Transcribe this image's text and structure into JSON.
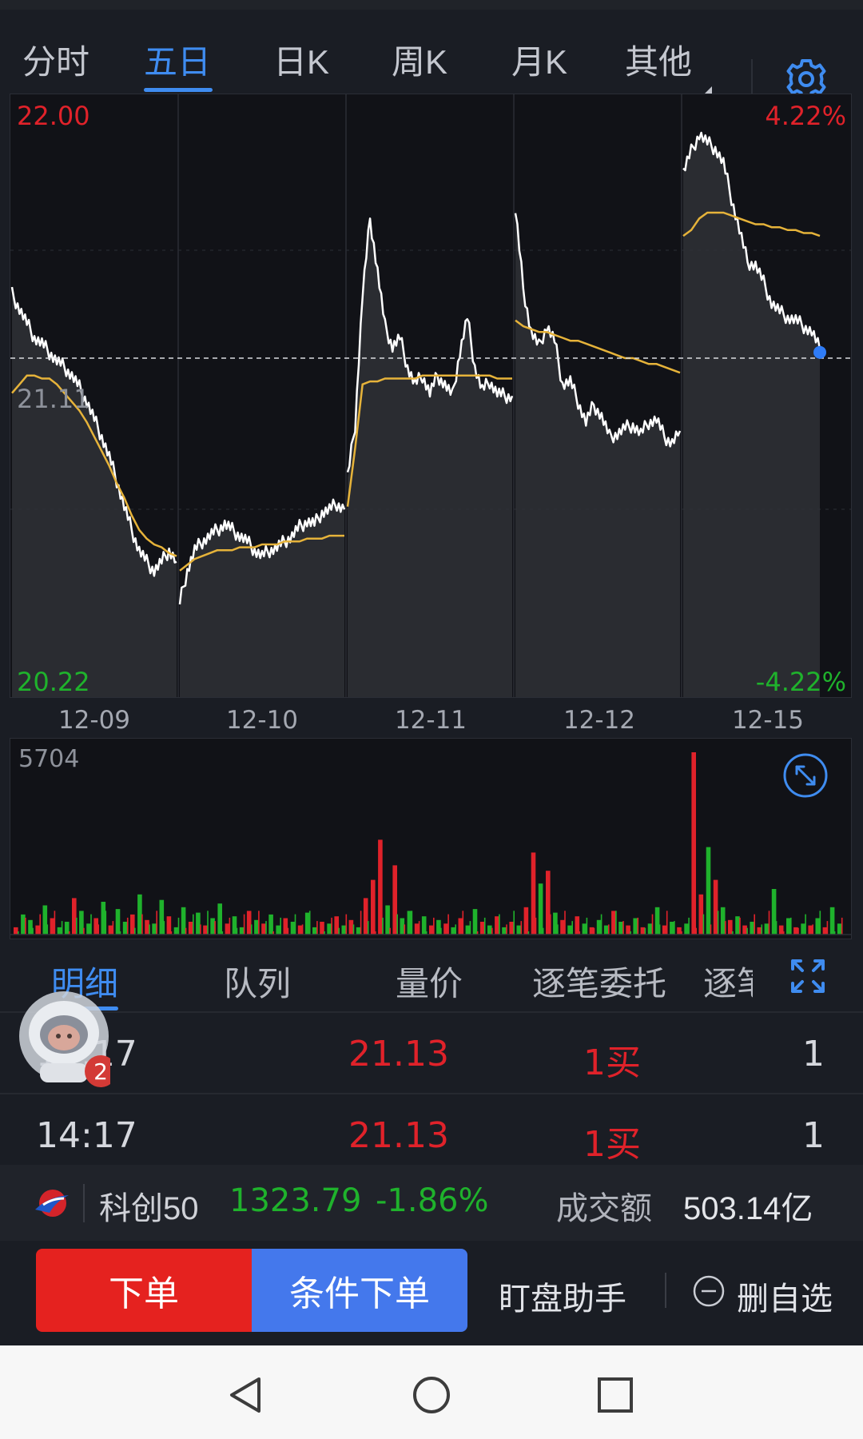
{
  "period_tabs": [
    {
      "label": "分时"
    },
    {
      "label": "五日"
    },
    {
      "label": "日K"
    },
    {
      "label": "周K"
    },
    {
      "label": "月K"
    },
    {
      "label": "其他"
    }
  ],
  "active_period_tab": "五日",
  "chart_data": {
    "type": "line",
    "y_top_price": "22.00",
    "y_mid_price": "21.11",
    "y_bottom_price": "20.22",
    "y_top_pct": "4.22%",
    "y_bottom_pct": "-4.22%",
    "ylim": [
      20.22,
      22.0
    ],
    "dates": [
      "12-09",
      "12-10",
      "12-11",
      "12-12",
      "12-15"
    ],
    "price_series": [
      [
        21.33,
        21.28,
        21.23,
        21.18,
        21.16,
        21.13,
        21.1,
        21.08,
        21.05,
        21.01,
        20.96,
        20.9,
        20.84,
        20.77,
        20.69,
        20.6,
        20.52,
        20.45,
        20.41,
        20.38,
        20.41,
        20.45,
        20.41
      ],
      [
        20.27,
        20.38,
        20.45,
        20.48,
        20.5,
        20.52,
        20.54,
        20.52,
        20.5,
        20.48,
        20.45,
        20.43,
        20.45,
        20.46,
        20.48,
        20.5,
        20.53,
        20.55,
        20.54,
        20.58,
        20.59,
        20.61,
        20.59
      ],
      [
        20.7,
        20.88,
        21.33,
        21.59,
        21.41,
        21.22,
        21.15,
        21.18,
        21.08,
        21.02,
        21.05,
        20.99,
        21.05,
        21.02,
        20.98,
        21.13,
        21.25,
        21.08,
        21.0,
        21.03,
        20.99,
        20.98,
        20.98
      ],
      [
        21.62,
        21.35,
        21.2,
        21.15,
        21.22,
        21.17,
        21.02,
        21.03,
        20.96,
        20.89,
        20.95,
        20.91,
        20.84,
        20.85,
        20.87,
        20.88,
        20.85,
        20.89,
        20.9,
        20.84,
        20.82,
        20.86
      ],
      [
        21.75,
        21.82,
        21.88,
        21.85,
        21.83,
        21.78,
        21.66,
        21.55,
        21.44,
        21.43,
        21.37,
        21.3,
        21.27,
        21.25,
        21.24,
        21.22,
        21.2,
        21.14
      ]
    ],
    "avg_series": [
      [
        20.99,
        21.02,
        21.05,
        21.05,
        21.04,
        21.04,
        21.02,
        20.99,
        20.96,
        20.93,
        20.89,
        20.84,
        20.79,
        20.74,
        20.68,
        20.63,
        20.57,
        20.52,
        20.49,
        20.47,
        20.46,
        20.44,
        20.43
      ],
      [
        20.38,
        20.4,
        20.42,
        20.43,
        20.44,
        20.45,
        20.45,
        20.45,
        20.46,
        20.46,
        20.46,
        20.47,
        20.47,
        20.47,
        20.48,
        20.48,
        20.48,
        20.49,
        20.49,
        20.49,
        20.5,
        20.5,
        20.5
      ],
      [
        20.6,
        20.8,
        21.02,
        21.03,
        21.03,
        21.04,
        21.04,
        21.04,
        21.04,
        21.04,
        21.05,
        21.05,
        21.05,
        21.05,
        21.05,
        21.05,
        21.05,
        21.05,
        21.05,
        21.05,
        21.04,
        21.04,
        21.04
      ],
      [
        21.24,
        21.22,
        21.21,
        21.2,
        21.2,
        21.19,
        21.18,
        21.17,
        21.17,
        21.16,
        21.15,
        21.14,
        21.13,
        21.12,
        21.11,
        21.11,
        21.1,
        21.09,
        21.09,
        21.08,
        21.07,
        21.06
      ],
      [
        21.53,
        21.55,
        21.59,
        21.61,
        21.61,
        21.61,
        21.6,
        21.59,
        21.58,
        21.57,
        21.57,
        21.56,
        21.56,
        21.55,
        21.55,
        21.54,
        21.54,
        21.53
      ]
    ],
    "last_price": 21.13,
    "volume_max": "5704",
    "volume_series": [
      0.04,
      0.11,
      0.08,
      0.05,
      0.16,
      0.09,
      0.04,
      0.07,
      0.2,
      0.13,
      0.06,
      0.09,
      0.18,
      0.05,
      0.14,
      0.07,
      0.11,
      0.22,
      0.08,
      0.06,
      0.19,
      0.1,
      0.04,
      0.15,
      0.07,
      0.12,
      0.05,
      0.09,
      0.17,
      0.06,
      0.1,
      0.04,
      0.13,
      0.08,
      0.06,
      0.11,
      0.05,
      0.09,
      0.07,
      0.05,
      0.12,
      0.04,
      0.07,
      0.06,
      0.1,
      0.05,
      0.08,
      0.04,
      0.2,
      0.3,
      0.52,
      0.16,
      0.38,
      0.09,
      0.13,
      0.06,
      0.1,
      0.05,
      0.08,
      0.06,
      0.04,
      0.09,
      0.05,
      0.14,
      0.07,
      0.05,
      0.1,
      0.04,
      0.07,
      0.05,
      0.15,
      0.45,
      0.28,
      0.35,
      0.12,
      0.08,
      0.05,
      0.1,
      0.06,
      0.04,
      0.08,
      0.05,
      0.13,
      0.07,
      0.05,
      0.09,
      0.04,
      0.06,
      0.15,
      0.05,
      0.07,
      0.04,
      0.06,
      1.0,
      0.22,
      0.48,
      0.3,
      0.15,
      0.08,
      0.1,
      0.05,
      0.07,
      0.04,
      0.06,
      0.25,
      0.05,
      0.09,
      0.04,
      0.06,
      0.05,
      0.09,
      0.04,
      0.15,
      0.06
    ],
    "volume_colors": [
      "r",
      "g",
      "g",
      "r",
      "g",
      "r",
      "g",
      "g",
      "r",
      "g",
      "g",
      "r",
      "g",
      "r",
      "g",
      "g",
      "r",
      "g",
      "r",
      "g",
      "g",
      "r",
      "g",
      "g",
      "r",
      "g",
      "r",
      "g",
      "g",
      "r",
      "g",
      "g",
      "r",
      "g",
      "r",
      "g",
      "g",
      "r",
      "g",
      "r",
      "g",
      "g",
      "r",
      "g",
      "r",
      "g",
      "r",
      "g",
      "r",
      "r",
      "r",
      "g",
      "r",
      "g",
      "g",
      "r",
      "g",
      "r",
      "g",
      "r",
      "g",
      "r",
      "g",
      "g",
      "r",
      "g",
      "r",
      "g",
      "r",
      "g",
      "r",
      "r",
      "g",
      "r",
      "g",
      "r",
      "g",
      "r",
      "g",
      "r",
      "g",
      "g",
      "r",
      "g",
      "r",
      "g",
      "r",
      "g",
      "g",
      "r",
      "g",
      "r",
      "g",
      "r",
      "r",
      "g",
      "r",
      "g",
      "r",
      "g",
      "r",
      "g",
      "r",
      "g",
      "g",
      "r",
      "g",
      "r",
      "g",
      "r",
      "g",
      "r",
      "g",
      "g"
    ]
  },
  "volume_expand_icon": "expand-arrows-icon",
  "detail_tabs": [
    {
      "label": "明细"
    },
    {
      "label": "队列"
    },
    {
      "label": "量价"
    },
    {
      "label": "逐笔委托"
    },
    {
      "label": "逐笔"
    }
  ],
  "trade_rows": [
    {
      "time": "14:17",
      "price": "21.13",
      "side": "1买",
      "qty": "1"
    },
    {
      "time": "14:17",
      "price": "21.13",
      "side": "1买",
      "qty": "1"
    }
  ],
  "assistant_badge": "2",
  "index_bar": {
    "name": "科创50",
    "value": "1323.79",
    "change": "-1.86%",
    "turnover_label": "成交额",
    "turnover_value": "503.14亿"
  },
  "actions": {
    "order": "下单",
    "conditional_order": "条件下单",
    "helper": "盯盘助手",
    "remove_watchlist": "删自选"
  },
  "colors": {
    "up": "#e0222a",
    "down": "#1fb22c",
    "accent": "#3f8cf0",
    "avg_line": "#e6b33a",
    "price_line": "#ffffff"
  }
}
